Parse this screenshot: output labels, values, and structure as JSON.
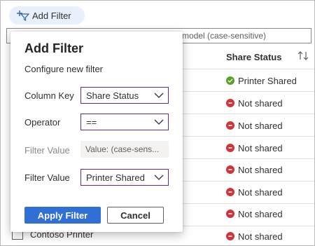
{
  "toolbar": {
    "add_filter_label": "Add Filter",
    "add_filter_icon": "add-filter-icon"
  },
  "search": {
    "placeholder_visible": "model (case-sensitive)"
  },
  "table": {
    "column_header": "Share Status",
    "rows": [
      {
        "status": "Printer Shared",
        "state": "shared"
      },
      {
        "status": "Not shared",
        "state": "not-shared"
      },
      {
        "status": "Not shared",
        "state": "not-shared"
      },
      {
        "status": "Not shared",
        "state": "not-shared"
      },
      {
        "status": "Not shared",
        "state": "not-shared"
      },
      {
        "status": "Not shared",
        "state": "not-shared"
      },
      {
        "status": "Not shared",
        "state": "not-shared"
      },
      {
        "status": "Not shared",
        "state": "not-shared"
      }
    ],
    "bottom_row_name": "Contoso Printer"
  },
  "dialog": {
    "title": "Add Filter",
    "subtitle": "Configure new filter",
    "column_key_label": "Column Key",
    "column_key_value": "Share Status",
    "operator_label": "Operator",
    "operator_value": "==",
    "filter_value_label_disabled": "Filter Value",
    "filter_value_placeholder": "Value: (case-sens...",
    "filter_value_label": "Filter Value",
    "filter_value_selected": "Printer Shared",
    "apply_label": "Apply Filter",
    "cancel_label": "Cancel"
  },
  "colors": {
    "accent": "#2f6fd6",
    "dropdown_border": "#5c2d91",
    "shared_green": "#58a229",
    "not_shared_red": "#d13438",
    "pill_bg": "#e8f0fb"
  }
}
